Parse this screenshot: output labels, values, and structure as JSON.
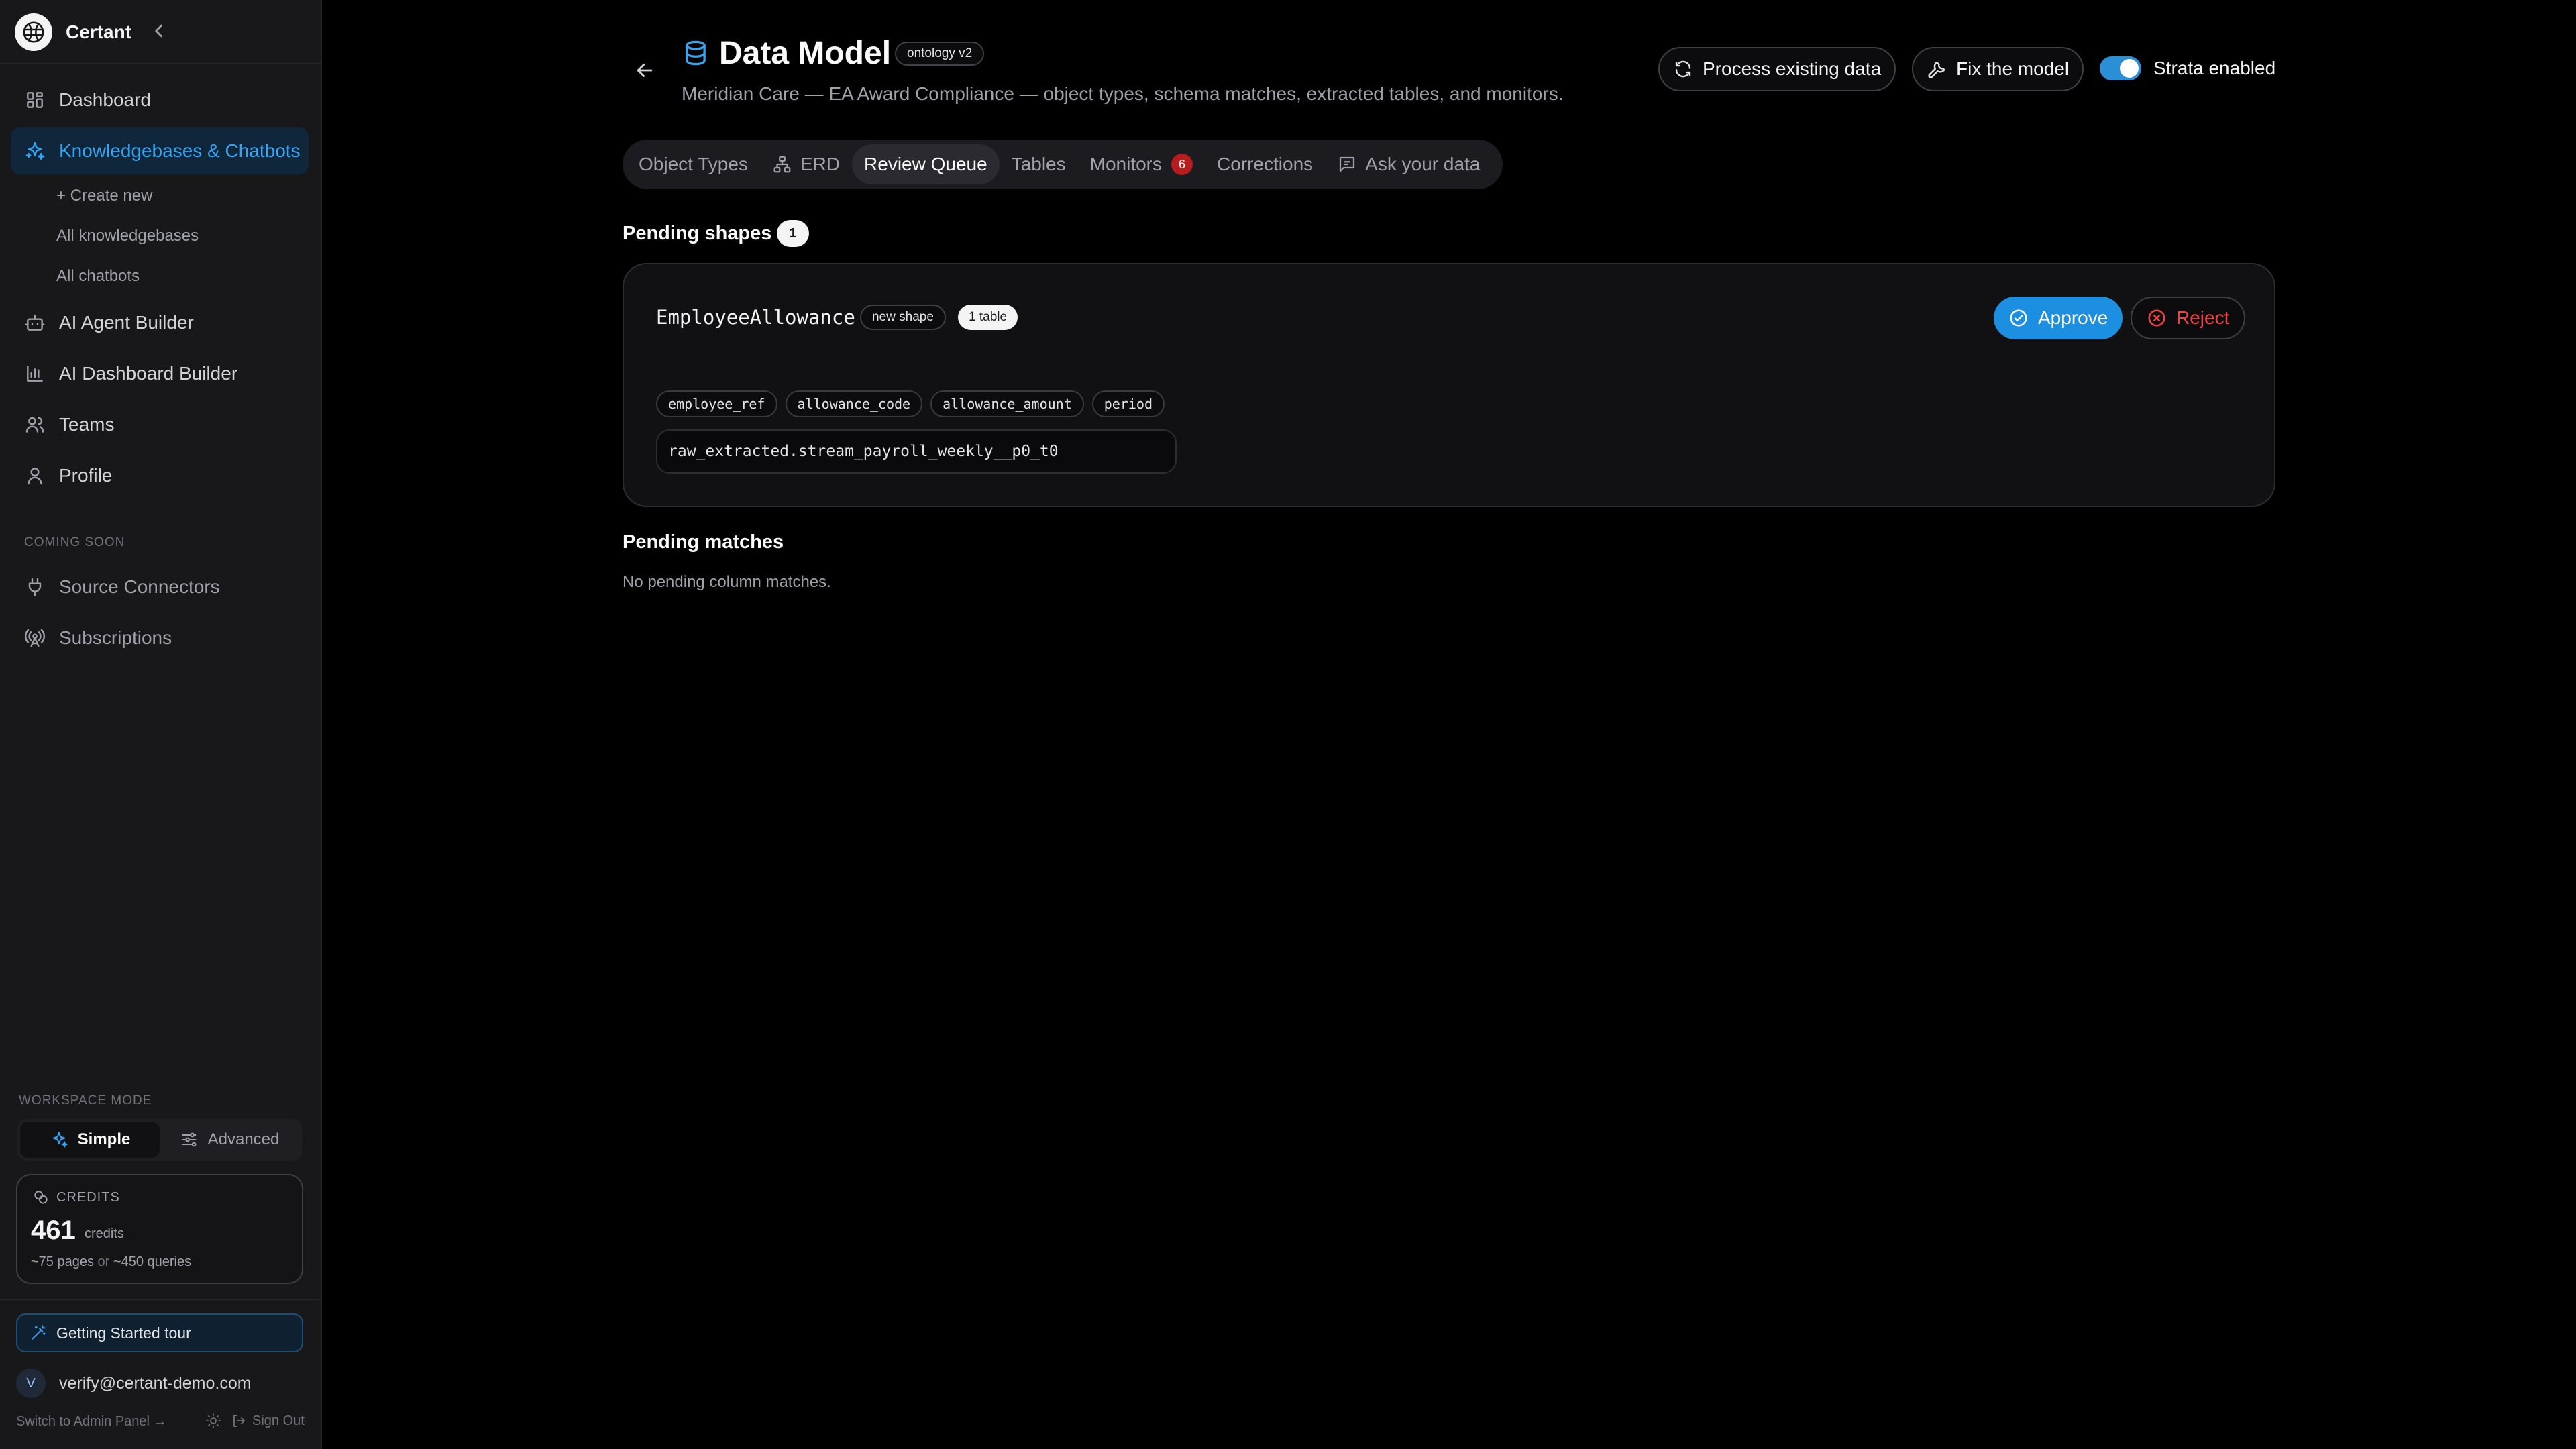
{
  "sidebar": {
    "brand": "Certant",
    "nav": [
      {
        "label": "Dashboard",
        "icon": "layout-grid-icon"
      },
      {
        "label": "Knowledgebases & Chatbots",
        "icon": "sparkles-icon",
        "active": true
      },
      {
        "label": "AI Agent Builder",
        "icon": "bot-icon"
      },
      {
        "label": "AI Dashboard Builder",
        "icon": "bar-chart-icon"
      },
      {
        "label": "Teams",
        "icon": "users-icon"
      },
      {
        "label": "Profile",
        "icon": "user-icon"
      }
    ],
    "sub_items": [
      "+ Create new",
      "All knowledgebases",
      "All chatbots"
    ],
    "coming_soon_label": "COMING SOON",
    "coming_soon": [
      {
        "label": "Source Connectors",
        "icon": "plug-icon"
      },
      {
        "label": "Subscriptions",
        "icon": "radio-tower-icon"
      }
    ],
    "workspace_mode": {
      "label": "WORKSPACE MODE",
      "options": [
        "Simple",
        "Advanced"
      ],
      "selected": "Simple"
    },
    "credits": {
      "label": "CREDITS",
      "value": "461",
      "unit": "credits",
      "pages": "~75 pages",
      "or": "or",
      "queries": "~450 queries"
    },
    "tour_label": "Getting Started tour",
    "user": {
      "initial": "V",
      "email": "verify@certant-demo.com"
    },
    "admin_link": "Switch to Admin Panel →",
    "sign_out": "Sign Out"
  },
  "header": {
    "title": "Data Model",
    "version": "ontology v2",
    "subtitle": "Meridian Care — EA Award Compliance — object types, schema matches, extracted tables, and monitors.",
    "process_label": "Process existing data",
    "fix_label": "Fix the model",
    "strata_label": "Strata enabled",
    "strata_enabled": true
  },
  "tabs": [
    {
      "label": "Object Types"
    },
    {
      "label": "ERD"
    },
    {
      "label": "Review Queue",
      "selected": true
    },
    {
      "label": "Tables"
    },
    {
      "label": "Monitors",
      "badge": "6"
    },
    {
      "label": "Corrections"
    },
    {
      "label": "Ask your data"
    }
  ],
  "pending_shapes": {
    "title": "Pending shapes",
    "count": "1",
    "items": [
      {
        "name": "EmployeeAllowance",
        "tag": "new shape",
        "tables": "1 table",
        "columns": [
          "employee_ref",
          "allowance_code",
          "allowance_amount",
          "period"
        ],
        "source": "raw_extracted.stream_payroll_weekly__p0_t0",
        "approve_label": "Approve",
        "reject_label": "Reject"
      }
    ]
  },
  "pending_matches": {
    "title": "Pending matches",
    "empty": "No pending column matches."
  },
  "colors": {
    "accent": "#38a3f0",
    "approve": "#1d8fe1",
    "reject": "#ef4444",
    "badge": "#b91c1c"
  }
}
